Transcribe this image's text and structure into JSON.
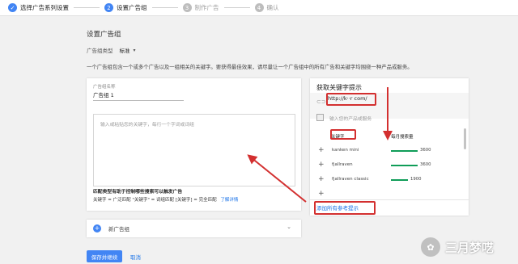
{
  "stepper": {
    "steps": [
      {
        "num": "✓",
        "label": "选择广告系列设置"
      },
      {
        "num": "2",
        "label": "设置广告组"
      },
      {
        "num": "3",
        "label": "制作广告"
      },
      {
        "num": "4",
        "label": "确认"
      }
    ]
  },
  "page": {
    "title": "设置广告组",
    "ad_group_type_label": "广告组类型",
    "ad_group_type_value": "标准",
    "description": "一个广告组包含一个或多个广告以及一组相关的关键字。要获得最佳效果，请尽量让一个广告组中的所有广告和关键字均围绕一种产品或服务。"
  },
  "ad_group": {
    "name_label": "广告组名称",
    "name_value": "广告组 1",
    "keywords_placeholder": "输入或粘贴您的关键字，每行一个字词或词组",
    "match_title": "匹配类型有助于控制哪些搜索可以触发广告",
    "match_desc": "关键字 = 广泛匹配  \"关键字\" = 词组匹配  [关键字] = 完全匹配",
    "learn_more": "了解详情"
  },
  "new_group": {
    "label": "新广告组"
  },
  "actions": {
    "save": "保存并继续",
    "cancel": "取消"
  },
  "keyword_ideas": {
    "title": "获取关键字提示",
    "url": "http://k··r   com/",
    "product_placeholder": "输入您的产品或服务",
    "col_keyword": "关键字",
    "col_volume": "每月搜索量",
    "rows": [
      {
        "keyword": "kanken mini",
        "volume": "3600",
        "level": 0.55
      },
      {
        "keyword": "fjallraven",
        "volume": "3600",
        "level": 0.55
      },
      {
        "keyword": "fjallraven classic",
        "volume": "1900",
        "level": 0.35
      }
    ],
    "add_all": "添加所有参考提示"
  },
  "watermark": {
    "text": "三月梦呓"
  },
  "colors": {
    "accent": "#4285f4",
    "link": "#1a73e8",
    "highlight": "#d32f2f",
    "bar": "#0f9d58"
  }
}
